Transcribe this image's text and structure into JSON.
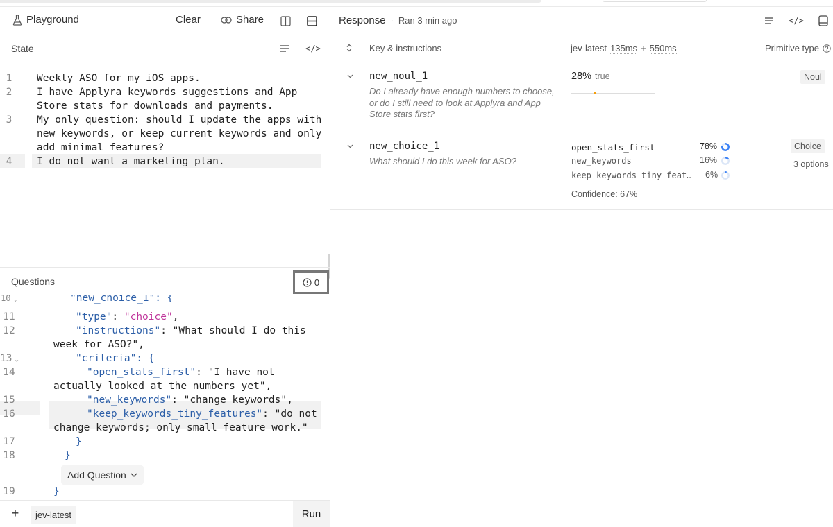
{
  "toolbar": {
    "title": "Playground",
    "clear_label": "Clear",
    "share_label": "Share"
  },
  "state": {
    "header": "State",
    "lines": [
      {
        "num": "1",
        "text": "Weekly ASO for my iOS apps."
      },
      {
        "num": "2",
        "text": "I have Applyra keywords suggestions and App"
      },
      {
        "num": "",
        "text": "Store stats for downloads and payments."
      },
      {
        "num": "3",
        "text": "My only question: should I update the apps with"
      },
      {
        "num": "",
        "text": "new keywords, or keep current keywords and only"
      },
      {
        "num": "",
        "text": "add minimal features?"
      },
      {
        "num": "4",
        "text": "I do not want a marketing plan."
      }
    ]
  },
  "questions": {
    "header": "Questions",
    "issue_count": "0",
    "partial_top": "\"new_choice_1\": {",
    "lines": {
      "l10": "10",
      "l11": "11",
      "t11a": "\"type\"",
      "t11b": ": ",
      "t11c": "\"choice\"",
      "t11d": ",",
      "l12": "12",
      "t12a": "\"instructions\"",
      "t12b": ": \"What should I do this",
      "t12c": "week for ASO?\",",
      "l13": "13",
      "t13a": "\"criteria\"",
      "t13b": ": {",
      "l14": "14",
      "t14a": "\"open_stats_first\"",
      "t14b": ": \"I have not",
      "t14c": "actually looked at the numbers yet\",",
      "l15": "15",
      "t15a": "\"new_keywords\"",
      "t15b": ": \"change keywords\",",
      "l16": "16",
      "t16a": "\"keep_keywords_tiny_features\"",
      "t16b": ": \"do not",
      "t16c": "change keywords; only small feature work.\"",
      "l17": "17",
      "t17": "}",
      "l18": "18",
      "t18": "}",
      "l19": "19",
      "t19": "}"
    },
    "add_question_label": "Add Question"
  },
  "footer": {
    "plus": "+",
    "model": "jev-latest",
    "run_label": "Run"
  },
  "response": {
    "title": "Response",
    "separator": "·",
    "ran": "Ran 3 min ago",
    "col_key": "Key & instructions",
    "col_model": "jev-latest",
    "time1": "135ms",
    "plus": "+",
    "time2": "550ms",
    "col_type": "Primitive type",
    "rows": [
      {
        "key": "new_noul_1",
        "instructions": "Do I already have enough numbers to choose, or do I still need to look at Applyra and App Store stats first?",
        "value_pct": "28%",
        "value_word": "true",
        "value_fraction": 0.28,
        "type": "Noul"
      },
      {
        "key": "new_choice_1",
        "instructions": "What should I do this week for ASO?",
        "options": [
          {
            "label": "open_stats_first",
            "pct": "78%",
            "value": 0.78
          },
          {
            "label": "new_keywords",
            "pct": "16%",
            "value": 0.16
          },
          {
            "label": "keep_keywords_tiny_feat…",
            "pct": "6%",
            "value": 0.06
          }
        ],
        "confidence": "Confidence: 67%",
        "type": "Choice",
        "type_sub": "3 options"
      }
    ]
  },
  "colors": {
    "accent_blue": "#3b82f6",
    "dot_orange": "#f59e0b",
    "string_blue": "#2d5fa8",
    "string_pink": "#c0369b"
  }
}
